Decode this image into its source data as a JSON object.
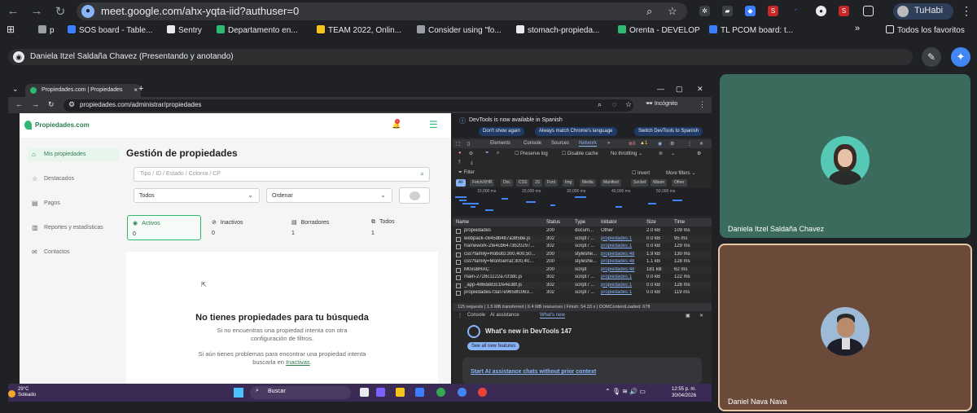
{
  "browser": {
    "url": "meet.google.com/ahx-yqta-iid?authuser=0",
    "profile_name": "TuHabi"
  },
  "bookmarks": [
    {
      "label": "p",
      "color": "#9aa0a6"
    },
    {
      "label": "SOS board - Table...",
      "color": "#3d7eff"
    },
    {
      "label": "Sentry",
      "color": "#e8eaed"
    },
    {
      "label": "Departamento en...",
      "color": "#2eb872"
    },
    {
      "label": "TEAM 2022, Onlin...",
      "color": "#f5c518"
    },
    {
      "label": "Consider using \"fo...",
      "color": "#9aa0a6"
    },
    {
      "label": "stomach-propieda...",
      "color": "#e8eaed"
    },
    {
      "label": "Orenta - DEVELOP",
      "color": "#2eb872"
    },
    {
      "label": "TL PCOM board: t...",
      "color": "#3d7eff"
    }
  ],
  "bookmarks_all": "Todos los favoritos",
  "meet": {
    "presenter_label": "Daniela Itzel Saldaña Chavez (Presentando y anotando)"
  },
  "inner_browser": {
    "tab_title": "Propiedades.com | Propiedades",
    "url": "propiedades.com/administrar/propiedades",
    "incognito_label": "Incógnito"
  },
  "app": {
    "logo_text": "Propiedades.com",
    "notification_count": "1",
    "sidebar": [
      {
        "label": "Mis propiedades",
        "icon": "home-icon",
        "active": true
      },
      {
        "label": "Destacados",
        "icon": "star-icon",
        "active": false
      },
      {
        "label": "Pagos",
        "icon": "payments-icon",
        "active": false
      },
      {
        "label": "Reportes y estadísticas",
        "icon": "chart-icon",
        "active": false
      },
      {
        "label": "Contactos",
        "icon": "mail-icon",
        "active": false
      }
    ],
    "page_title": "Gestión de propiedades",
    "search_placeholder": "Tipo / ID / Estado / Colonia / CP",
    "filter_status": "Todos",
    "sort_label": "Ordenar",
    "status_cards": [
      {
        "label": "Activos",
        "count": "0",
        "icon": "eye-icon",
        "active": true
      },
      {
        "label": "Inactivos",
        "count": "0",
        "icon": "eye-off-icon",
        "active": false
      },
      {
        "label": "Borradores",
        "count": "1",
        "icon": "draft-icon",
        "active": false
      },
      {
        "label": "Todos",
        "count": "1",
        "icon": "all-icon",
        "active": false
      }
    ],
    "empty_title": "No tienes propiedades para tu búsqueda",
    "empty_text1": "Si no encuentras una propiedad intenta con otra configuración de filtros.",
    "empty_text2": "Si aún tienes problemas para encontrar una propiedad intenta buscarla en",
    "empty_link": "Inactivas"
  },
  "devtools": {
    "info_text": "DevTools is now available in Spanish",
    "pill_dont_show": "Don't show again",
    "pill_match": "Always match Chrome's language",
    "pill_switch": "Switch DevTools to Spanish",
    "tabs": [
      "Elements",
      "Console",
      "Sources",
      "Network"
    ],
    "active_tab": "Network",
    "preserve_log": "Preserve log",
    "disable_cache": "Disable cache",
    "throttling": "No throttling",
    "filter_placeholder": "Filter",
    "invert": "Invert",
    "more_filters": "More filters",
    "type_chips": [
      "All",
      "Fetch/XHR",
      "Doc",
      "CSS",
      "JS",
      "Font",
      "Img",
      "Media",
      "Manifest",
      "Socket",
      "Wasm",
      "Other"
    ],
    "timeline_labels": [
      "10,000 ms",
      "20,000 ms",
      "30,000 ms",
      "40,000 ms",
      "50,000 ms"
    ],
    "columns": [
      "Name",
      "Status",
      "Type",
      "Initiator",
      "Size",
      "Time"
    ],
    "rows": [
      {
        "name": "propiedades",
        "status": "200",
        "type": "docum...",
        "initiator": "Other",
        "size": "2.0 kB",
        "time": "109 ms"
      },
      {
        "name": "webpack-c645db4b7a385be.js",
        "status": "302",
        "type": "script / ...",
        "initiator": "propiedades:1",
        "size": "0.0 kB",
        "time": "95 ms"
      },
      {
        "name": "framework-2fe4cb6473b20297...",
        "status": "302",
        "type": "script / ...",
        "initiator": "propiedades:1",
        "size": "0.0 kB",
        "time": "129 ms"
      },
      {
        "name": "css?family=Roboto:300,400,50...",
        "status": "200",
        "type": "styleshe...",
        "initiator": "propiedades:48",
        "size": "1.9 kB",
        "time": "130 ms"
      },
      {
        "name": "css?family=Montserrat:300,40...",
        "status": "200",
        "type": "styleshe...",
        "initiator": "propiedades:48",
        "size": "1.1 kB",
        "time": "128 ms"
      },
      {
        "name": "M0xsBRAC",
        "status": "200",
        "type": "script",
        "initiator": "propiedades:48",
        "size": "181 kB",
        "time": "62 ms"
      },
      {
        "name": "main-2728c1122a7cf3dc.js",
        "status": "302",
        "type": "script / ...",
        "initiator": "propiedades:1",
        "size": "0.0 kB",
        "time": "122 ms"
      },
      {
        "name": "_app-486de83c1fe4e38f.js",
        "status": "302",
        "type": "script / ...",
        "initiator": "propiedades:1",
        "size": "0.0 kB",
        "time": "128 ms"
      },
      {
        "name": "propiedades-f3af7e9658fc063...",
        "status": "302",
        "type": "script / ...",
        "initiator": "propiedades:1",
        "size": "0.0 kB",
        "time": "119 ms"
      }
    ],
    "status_bar": "115 requests  |  1.5 MB transferred  |  6.4 MB resources  |  Finish: 54.33 s  |  DOMContentLoaded: 678",
    "drawer_tabs": [
      "Console",
      "AI assistance",
      "What's new"
    ],
    "whats_new_title": "What's new in DevTools 147",
    "whats_new_button": "See all new features",
    "whats_new_link": "Start AI assistance chats without prior context"
  },
  "taskbar": {
    "temperature": "29°C",
    "weather": "Soleado",
    "search": "Buscar",
    "time": "12:55 p. m.",
    "date": "30/04/2026"
  },
  "participants": [
    {
      "name": "Daniela Itzel Saldaña Chavez"
    },
    {
      "name": "Daniel Nava Nava"
    }
  ]
}
